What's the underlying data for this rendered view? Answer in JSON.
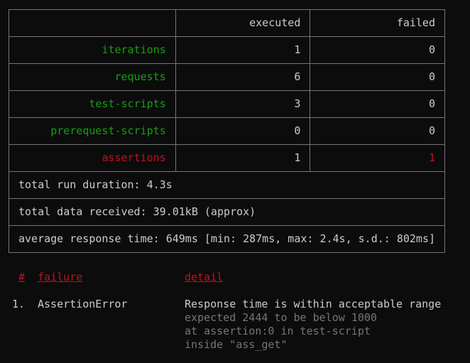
{
  "summary": {
    "headers": {
      "label": "",
      "executed": "executed",
      "failed": "failed"
    },
    "rows": [
      {
        "label": "iterations",
        "executed": "1",
        "failed": "0"
      },
      {
        "label": "requests",
        "executed": "6",
        "failed": "0"
      },
      {
        "label": "test-scripts",
        "executed": "3",
        "failed": "0"
      },
      {
        "label": "prerequest-scripts",
        "executed": "0",
        "failed": "0"
      },
      {
        "label": "assertions",
        "executed": "1",
        "failed": "1"
      }
    ],
    "duration": "total run duration: 4.3s",
    "data_received": "total data received: 39.01kB (approx)",
    "response_time": "average response time: 649ms [min: 287ms, max: 2.4s, s.d.: 802ms]"
  },
  "failures": {
    "headers": {
      "hash": "#",
      "failure": "failure",
      "detail": "detail"
    },
    "items": [
      {
        "index": "1.",
        "type": "AssertionError",
        "title": "Response time is within acceptable range",
        "lines": [
          "expected 2444 to be below 1000",
          "at assertion:0 in test-script",
          "inside \"ass_get\""
        ]
      }
    ]
  },
  "colors": {
    "background": "#0c0c0c",
    "text": "#cccccc",
    "green": "#13a10e",
    "red": "#c50f1f",
    "border": "#767676"
  }
}
